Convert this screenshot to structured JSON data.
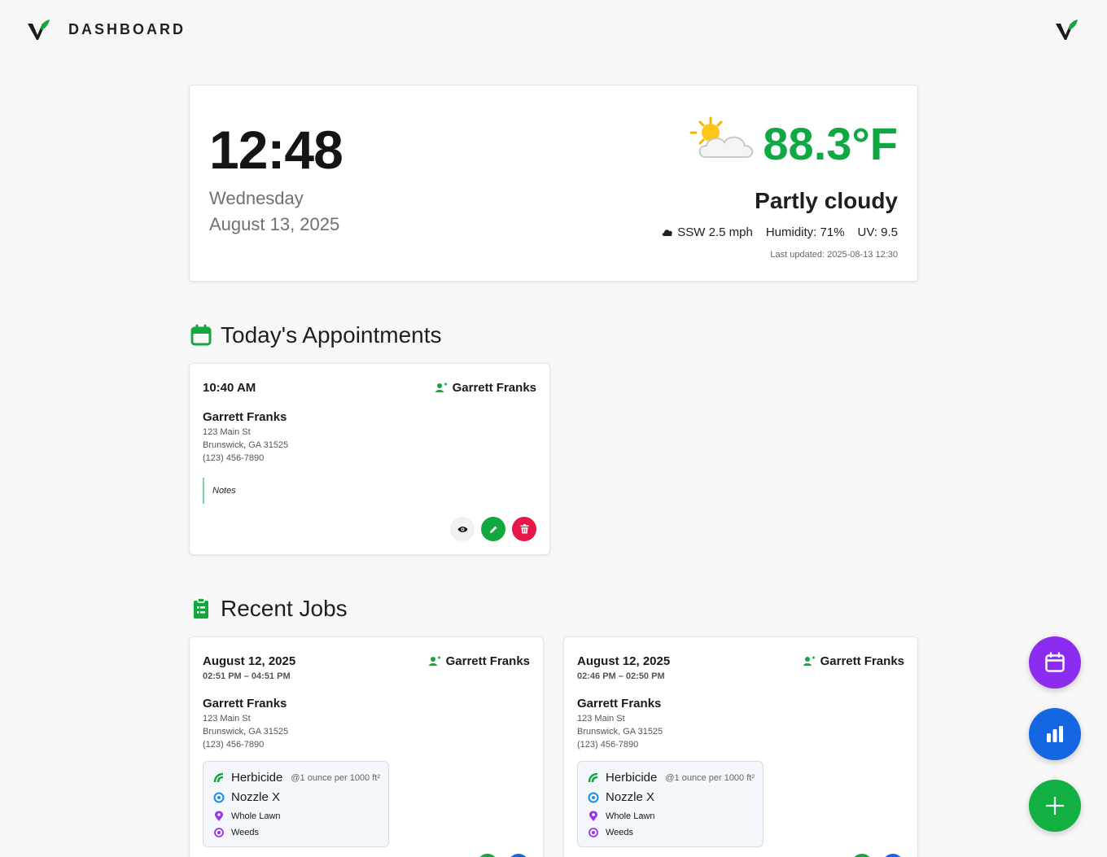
{
  "header": {
    "title": "DASHBOARD"
  },
  "clock": {
    "time": "12:48",
    "weekday": "Wednesday",
    "date": "August 13, 2025"
  },
  "weather": {
    "temperature": "88.3°F",
    "condition": "Partly cloudy",
    "wind": "SSW 2.5 mph",
    "humidity": "Humidity: 71%",
    "uv": "UV: 9.5",
    "last_updated": "Last updated: 2025-08-13 12:30",
    "icon": "partly-cloudy-icon",
    "temp_color": "#10a843"
  },
  "appointments": {
    "title": "Today's Appointments",
    "items": [
      {
        "time": "10:40 AM",
        "assignee": "Garrett Franks",
        "customer": "Garrett Franks",
        "address1": "123 Main St",
        "address2": "Brunswick, GA 31525",
        "phone": "(123) 456-7890",
        "notes": "Notes"
      }
    ]
  },
  "jobs": {
    "title": "Recent Jobs",
    "items": [
      {
        "date": "August 12, 2025",
        "range": "02:51 PM – 04:51 PM",
        "assignee": "Garrett Franks",
        "customer": "Garrett Franks",
        "address1": "123 Main St",
        "address2": "Brunswick, GA 31525",
        "phone": "(123) 456-7890",
        "product": "Herbicide",
        "rate": "@1 ounce per 1000 ft²",
        "nozzle": "Nozzle X",
        "area": "Whole Lawn",
        "target": "Weeds"
      },
      {
        "date": "August 12, 2025",
        "range": "02:46 PM – 02:50 PM",
        "assignee": "Garrett Franks",
        "customer": "Garrett Franks",
        "address1": "123 Main St",
        "address2": "Brunswick, GA 31525",
        "phone": "(123) 456-7890",
        "product": "Herbicide",
        "rate": "@1 ounce per 1000 ft²",
        "nozzle": "Nozzle X",
        "area": "Whole Lawn",
        "target": "Weeds"
      }
    ]
  },
  "colors": {
    "green": "#13a73f",
    "red": "#e8174a",
    "purple": "#8b2cf0",
    "blue": "#1466e2"
  }
}
